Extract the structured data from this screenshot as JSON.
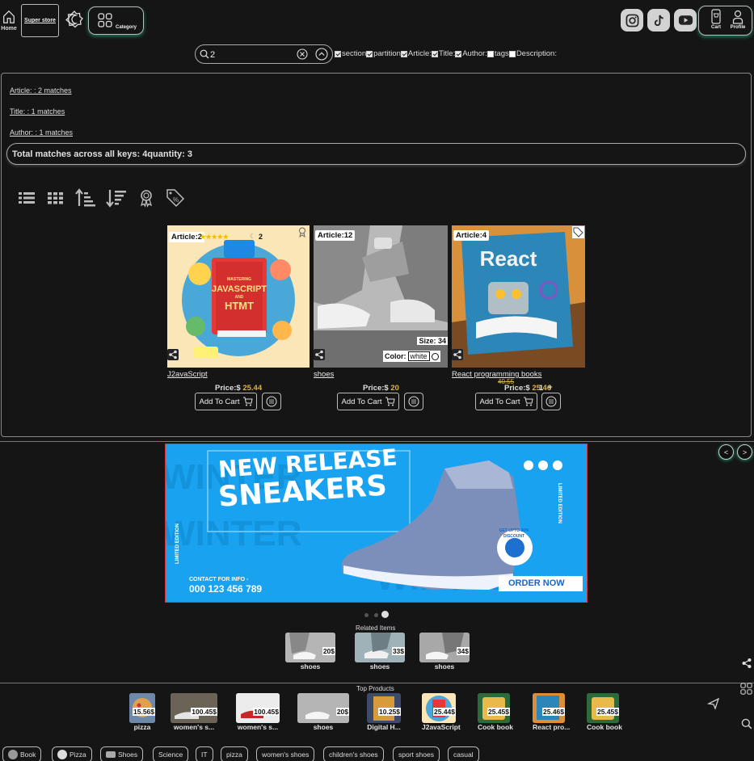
{
  "header": {
    "home_label": "Home",
    "brand_label": "Super store",
    "category_label": "Category",
    "cart_label": "Cart",
    "profile_label": "Profile",
    "social_icons": [
      "instagram-icon",
      "tiktok-icon",
      "youtube-icon"
    ]
  },
  "search": {
    "value": "2",
    "filters": [
      {
        "label": "section",
        "checked": true
      },
      {
        "label": "partition",
        "checked": true
      },
      {
        "label": "Article:",
        "checked": true
      },
      {
        "label": "Title:",
        "checked": true
      },
      {
        "label": "Author:",
        "checked": true
      },
      {
        "label": "tags",
        "checked": false
      },
      {
        "label": "Description:",
        "checked": false
      }
    ]
  },
  "results": {
    "matches": [
      "Article: : 2 matches",
      "Title: : 1 matches",
      "Author: : 1 matches"
    ],
    "total": "Total matches across all keys: 4quantity: 3"
  },
  "toolbar_icons": [
    "list-view-icon",
    "grid-view-icon",
    "sort-ascending-icon",
    "sort-descending-icon",
    "award-icon",
    "discount-tag-icon"
  ],
  "products": [
    {
      "badge": "Article:2",
      "rating_count": "2",
      "name": "J2avaScript",
      "price_prefix": "Price:$",
      "price": "25.44",
      "add_label": "Add To Cart"
    },
    {
      "badge": "Article:12",
      "size_label": "Size: 34",
      "color_label": "Color:",
      "color_value": "white",
      "name": "shoes",
      "price_prefix": "Price:$",
      "price": "20",
      "add_label": "Add To Cart"
    },
    {
      "badge": "Article:4",
      "old_price": "40.55",
      "qty": "1",
      "qty_plus": "+",
      "name": "React programming books",
      "price_prefix": "Price:$",
      "price": "25.46",
      "add_label": "Add To Cart"
    }
  ],
  "banner": {
    "headline_1": "NEW RELEASE",
    "headline_2": "SNEAKERS",
    "side_left": "LIMITED EDITION",
    "side_right": "LIMITED EDITION",
    "contact_label": "CONTACT FOR INFO -",
    "phone": "000 123 456 789",
    "cta": "ORDER NOW",
    "discount": "GET UPTO 30% DISCOUNT",
    "prev": "<",
    "next": ">"
  },
  "related": {
    "title": "Related Items",
    "items": [
      {
        "price": "20$",
        "name": "shoes"
      },
      {
        "price": "33$",
        "name": "shoes"
      },
      {
        "price": "34$",
        "name": "shoes"
      }
    ]
  },
  "top_products": {
    "title": "Top Products",
    "items": [
      {
        "price": "15.56$",
        "name": "pizza"
      },
      {
        "price": "100.45$",
        "name": "women's s..."
      },
      {
        "price": "100.45$",
        "name": "women's s..."
      },
      {
        "price": "20$",
        "name": "shoes"
      },
      {
        "price": "10.25$",
        "name": "Digital H..."
      },
      {
        "price": "25.44$",
        "name": "J2avaScript"
      },
      {
        "price": "25.45$",
        "name": "Cook book"
      },
      {
        "price": "25.46$",
        "name": "React pro..."
      },
      {
        "price": "25.45$",
        "name": "Cook book"
      }
    ]
  },
  "tags": [
    "Book",
    "Pizza",
    "Shoes",
    "Science",
    "IT",
    "pizza",
    "women's shoes",
    "children's shoes",
    "sport shoes",
    "casual"
  ],
  "colors": {
    "accent_glow": "#2fc896",
    "price_gold": "#d9b248",
    "banner_blue": "#1aa0ee"
  }
}
